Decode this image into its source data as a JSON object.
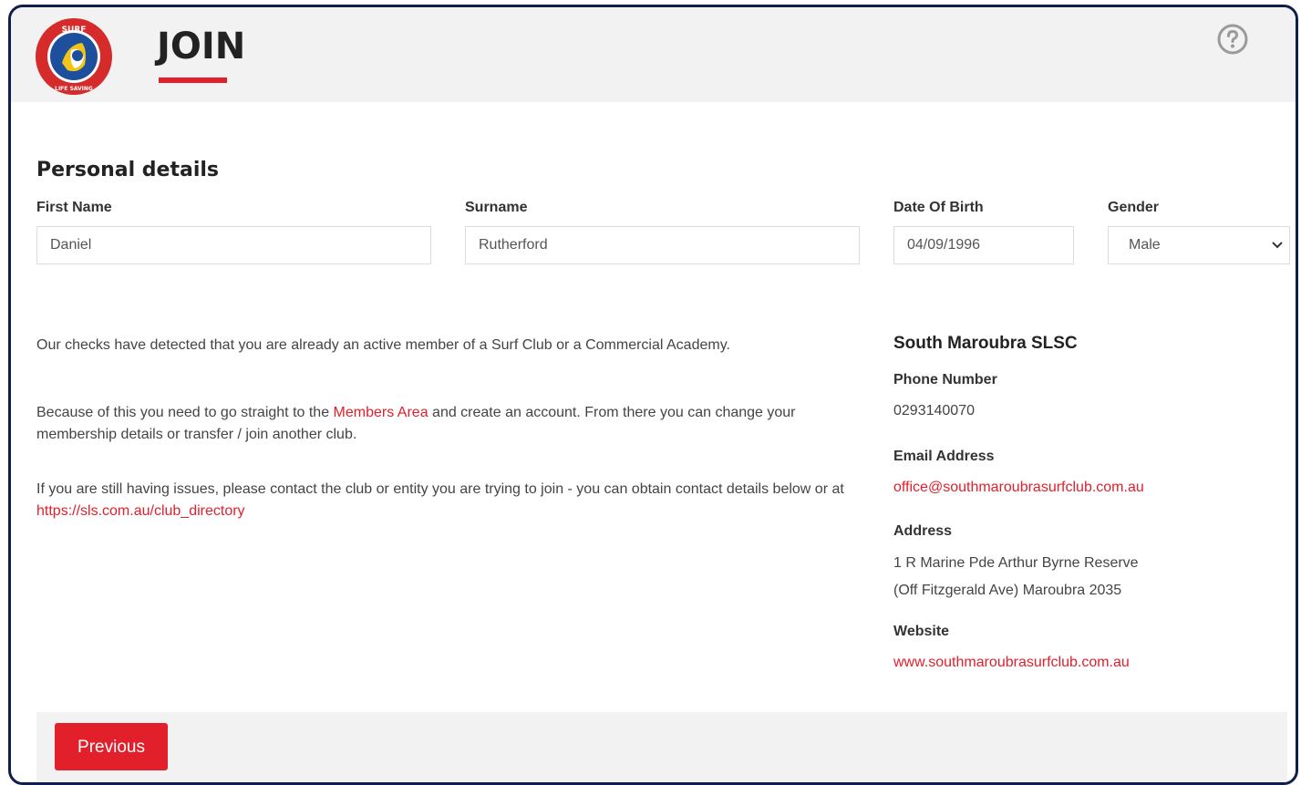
{
  "header": {
    "title": "JOIN",
    "logo_text": "SURF LIFE SAVING",
    "help_icon": "question-circle-icon"
  },
  "personal": {
    "section_title": "Personal details",
    "first_name_label": "First Name",
    "first_name_value": "Daniel",
    "surname_label": "Surname",
    "surname_value": "Rutherford",
    "dob_label": "Date Of Birth",
    "dob_value": "04/09/1996",
    "gender_label": "Gender",
    "gender_value": "Male"
  },
  "message": {
    "para1": "Our checks have detected that you are already an active member of a Surf Club or a Commercial Academy.",
    "para2_before": "Because of this you need to go straight to the ",
    "para2_link": "Members Area",
    "para2_after": " and create an account. From there you can change your membership details or transfer / join another club.",
    "para3_before": "If you are still having issues, please contact the club or entity you are trying to join - you can obtain contact details below or at ",
    "para3_link": "https://sls.com.au/club_directory"
  },
  "club": {
    "name": "South Maroubra SLSC",
    "phone_label": "Phone Number",
    "phone_value": "0293140070",
    "email_label": "Email Address",
    "email_value": "office@southmaroubrasurfclub.com.au",
    "address_label": "Address",
    "address_line1": "1 R Marine Pde Arthur Byrne Reserve",
    "address_line2": "(Off Fitzgerald Ave) Maroubra 2035",
    "website_label": "Website",
    "website_value": "www.southmaroubrasurfclub.com.au"
  },
  "footer": {
    "previous_label": "Previous"
  },
  "colors": {
    "accent": "#e1202c",
    "frame_border": "#0f1f4a",
    "header_bg": "#f2f2f2",
    "logo_blue": "#1d4f9c",
    "logo_red": "#d52b2b",
    "logo_yellow": "#f2c318"
  }
}
